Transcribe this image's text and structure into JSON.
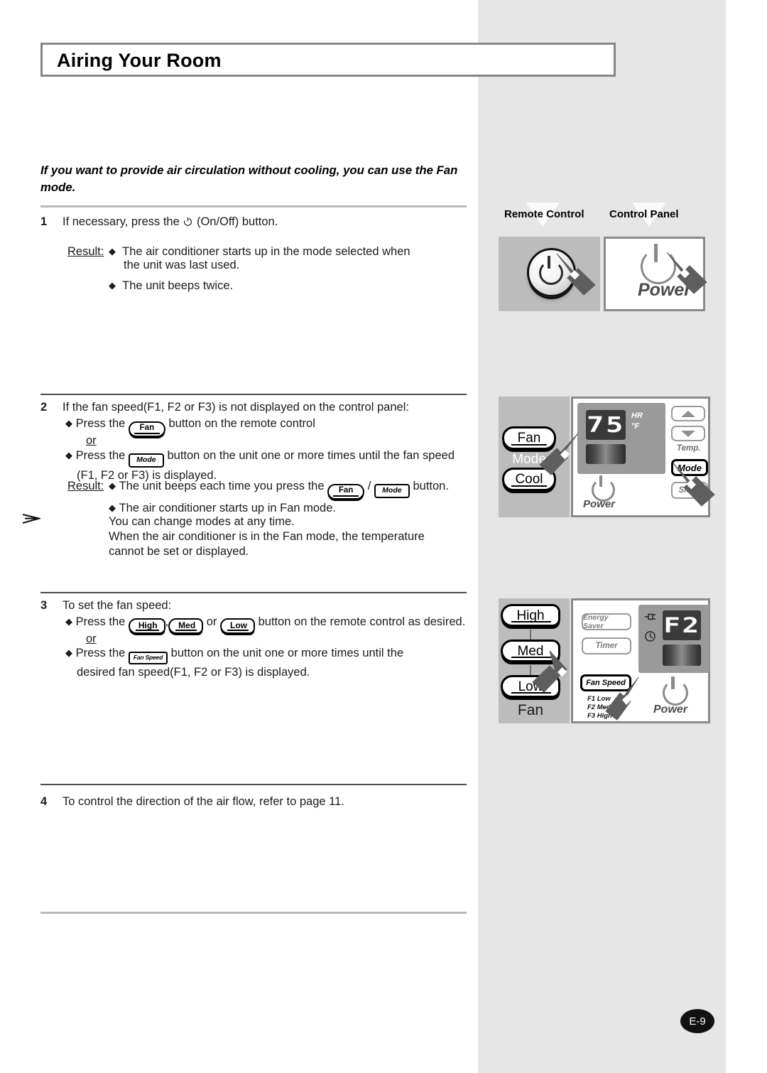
{
  "page": {
    "title": "Airing Your Room",
    "page_number": "E-9",
    "intro": "If you want to provide air circulation without cooling, you can use the Fan mode."
  },
  "steps": [
    {
      "number": "1",
      "lines": [
        "If necessary, press the",
        "(On/Off) button."
      ],
      "power_icon": "power-icon",
      "result_label": "Result:",
      "result_bullets": [
        "The air conditioner starts up in the mode selected when",
        "the unit was last used.",
        "The unit beeps twice."
      ]
    },
    {
      "number": "2",
      "intro": "If the fan speed(F1, F2 or F3) is not displayed on the control panel:",
      "bullet1_pre": "Press the",
      "bullet1_key": "Fan",
      "bullet1_post": "button on the remote control",
      "or_label": "or",
      "bullet2_pre": "Press the",
      "bullet2_key": "Mode",
      "bullet2_post": "button on the unit one or more times until the fan speed",
      "bullet2_cont": "(F1, F2 or F3) is displayed.",
      "result_label": "Result:",
      "result1_pre": "The unit beeps each time you press the",
      "result1_key1": "Fan",
      "result1_sep": "/",
      "result1_key2": "Mode",
      "result1_post": "button.",
      "result2": "The air conditioner starts up in Fan mode.",
      "note_lines": [
        "You can change modes at any time.",
        "When the air conditioner is in the Fan mode, the temperature",
        "cannot be set or displayed."
      ]
    },
    {
      "number": "3",
      "intro": "To set the fan speed:",
      "bullet1_pre": "Press the",
      "bullet1_keys": [
        "High",
        "Med",
        "Low"
      ],
      "bullet1_mid": ",",
      "bullet1_or": "or",
      "bullet1_post": "button on the remote control as desired.",
      "or_label": "or",
      "bullet2_pre": "Press the",
      "bullet2_key": "Fan Speed",
      "bullet2_post": "button on the unit one or more times until the",
      "bullet2_cont": "desired fan speed(F1, F2 or F3) is displayed."
    },
    {
      "number": "4",
      "text": "To control the direction of the air flow, refer to page 11."
    }
  ],
  "figures": [
    {
      "id": "figure-power",
      "remote_label": "Remote Control",
      "panel_label": "Control Panel",
      "remote_icon": "power-icon",
      "panel_icon": "power-icon",
      "panel_power_text": "Power"
    },
    {
      "id": "figure-fan-mode",
      "remote_buttons": [
        "Fan",
        "Cool"
      ],
      "remote_center_label": "Mode",
      "display_value": "75",
      "display_units": [
        "HR",
        "°F"
      ],
      "panel_temp_label": "Temp.",
      "panel_mode_label": "Mode",
      "panel_sleep_label": "Sleep",
      "panel_power_label": "Power",
      "temp_up_icon": "arrow-up-icon",
      "temp_down_icon": "arrow-down-icon"
    },
    {
      "id": "figure-fan-speed",
      "remote_buttons": [
        "High",
        "Med",
        "Low"
      ],
      "remote_group_label": "Fan",
      "panel_energy_saver": "Energy Saver",
      "panel_timer": "Timer",
      "panel_fan_speed": "Fan Speed",
      "fan_speed_legend": [
        "F1 Low",
        "F2 Med",
        "F3 High"
      ],
      "display_value": "F2",
      "panel_power_label": "Power",
      "plug_icon": "plug-icon",
      "clock_icon": "clock-icon"
    }
  ],
  "colors": {
    "band": "#e6e6e6",
    "remote_bg": "#bcbcbc",
    "panel_inner": "#9a9a9a",
    "display_bg": "#3a3a3a",
    "rule": "#b9b9b9",
    "pointer": "#5e5e5e"
  }
}
